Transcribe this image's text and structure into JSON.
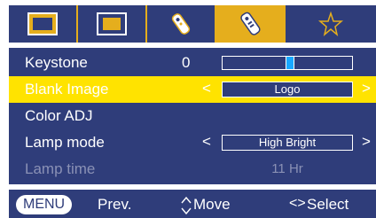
{
  "tabs": [
    {
      "name": "picture-icon",
      "active": false
    },
    {
      "name": "screen-icon",
      "active": false
    },
    {
      "name": "tool-icon",
      "active": false
    },
    {
      "name": "remote-control-icon",
      "active": true
    },
    {
      "name": "star-icon",
      "active": false
    }
  ],
  "menu": {
    "keystone": {
      "label": "Keystone",
      "value": "0",
      "slider_fraction": 0.52
    },
    "blank_image": {
      "label": "Blank Image",
      "value": "Logo",
      "left_arrow": "<",
      "right_arrow": ">"
    },
    "color_adj": {
      "label": "Color ADJ"
    },
    "lamp_mode": {
      "label": "Lamp mode",
      "value": "High Bright",
      "left_arrow": "<",
      "right_arrow": ">"
    },
    "lamp_time": {
      "label": "Lamp time",
      "value": "11 Hr"
    }
  },
  "footer": {
    "menu_key": "MENU",
    "prev_label": "Prev.",
    "move_label": "Move",
    "select_key": "<>",
    "select_label": "Select"
  },
  "colors": {
    "panel": "#2f3d7a",
    "accent": "#e5ae1d",
    "selected": "#ffe300",
    "slider_knob": "#18a8ff"
  }
}
